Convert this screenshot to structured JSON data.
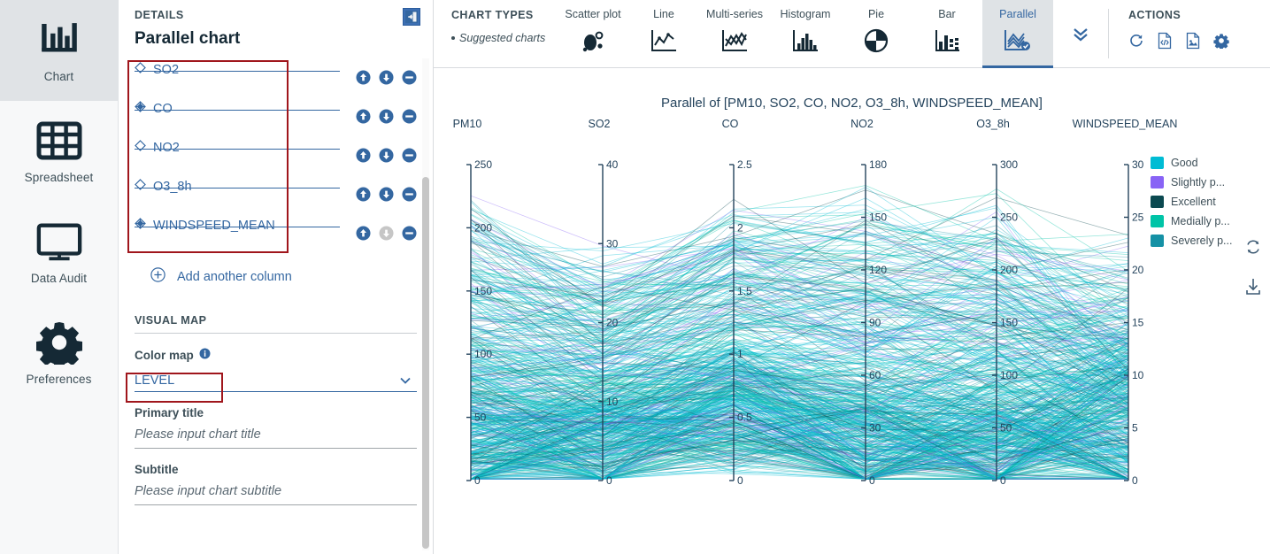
{
  "rail": {
    "items": [
      {
        "label": "Chart",
        "icon": "bar-chart-icon",
        "active": true
      },
      {
        "label": "Spreadsheet",
        "icon": "grid-icon",
        "active": false
      },
      {
        "label": "Data Audit",
        "icon": "monitor-icon",
        "active": false
      },
      {
        "label": "Preferences",
        "icon": "gear-icon",
        "active": false
      }
    ]
  },
  "details": {
    "kicker": "DETAILS",
    "title": "Parallel chart",
    "collapse_icon": "collapse-panel-icon",
    "columns": [
      {
        "name": "SO2",
        "icon": "diamond-outline-icon",
        "up": "move-up-icon",
        "down": "move-down-icon",
        "remove": "remove-icon",
        "down_disabled": false
      },
      {
        "name": "CO",
        "icon": "diamond-filled-icon",
        "up": "move-up-icon",
        "down": "move-down-icon",
        "remove": "remove-icon",
        "down_disabled": false
      },
      {
        "name": "NO2",
        "icon": "diamond-outline-icon",
        "up": "move-up-icon",
        "down": "move-down-icon",
        "remove": "remove-icon",
        "down_disabled": false
      },
      {
        "name": "O3_8h",
        "icon": "diamond-outline-icon",
        "up": "move-up-icon",
        "down": "move-down-icon",
        "remove": "remove-icon",
        "down_disabled": false
      },
      {
        "name": "WINDSPEED_MEAN",
        "icon": "diamond-filled-icon",
        "up": "move-up-icon",
        "down": "move-down-icon",
        "remove": "remove-icon",
        "down_disabled": true
      }
    ],
    "add_column_label": "Add another column",
    "visual_map_header": "VISUAL MAP",
    "color_map_label": "Color map",
    "color_map_value": "LEVEL",
    "primary_title_label": "Primary title",
    "primary_title_value": "",
    "primary_title_placeholder": "Please input chart title",
    "subtitle_label": "Subtitle",
    "subtitle_value": "",
    "subtitle_placeholder": "Please input chart subtitle"
  },
  "topbar": {
    "chart_types_label": "CHART TYPES",
    "suggested_label": "Suggested charts",
    "types": [
      {
        "label": "Scatter plot",
        "icon": "scatter-plot-icon",
        "selected": false
      },
      {
        "label": "Line",
        "icon": "line-chart-icon",
        "selected": false
      },
      {
        "label": "Multi-series",
        "icon": "multi-series-icon",
        "selected": false
      },
      {
        "label": "Histogram",
        "icon": "histogram-icon",
        "selected": false
      },
      {
        "label": "Pie",
        "icon": "pie-chart-icon",
        "selected": false
      },
      {
        "label": "Bar",
        "icon": "bar-chart-icon",
        "selected": false
      },
      {
        "label": "Parallel",
        "icon": "parallel-chart-icon",
        "selected": true
      }
    ],
    "more_icon": "chevron-double-down-icon",
    "actions_label": "ACTIONS",
    "actions": [
      {
        "name": "refresh-icon"
      },
      {
        "name": "code-export-icon"
      },
      {
        "name": "image-export-icon"
      },
      {
        "name": "settings-gear-icon"
      }
    ]
  },
  "side_tools": [
    {
      "name": "reset-zoom-icon"
    },
    {
      "name": "download-icon"
    }
  ],
  "chart_data": {
    "type": "parallel",
    "title": "Parallel of [PM10, SO2, CO, NO2, O3_8h, WINDSPEED_MEAN]",
    "axes": [
      {
        "name": "PM10",
        "ticks": [
          0,
          50,
          100,
          150,
          200,
          250
        ],
        "min": 0,
        "max": 250
      },
      {
        "name": "SO2",
        "ticks": [
          0,
          10,
          20,
          30,
          40
        ],
        "min": 0,
        "max": 40
      },
      {
        "name": "CO",
        "ticks": [
          0,
          0.5,
          1,
          1.5,
          2,
          2.5
        ],
        "min": 0,
        "max": 2.5
      },
      {
        "name": "NO2",
        "ticks": [
          0,
          30,
          60,
          90,
          120,
          150,
          180
        ],
        "min": 0,
        "max": 180
      },
      {
        "name": "O3_8h",
        "ticks": [
          0,
          50,
          100,
          150,
          200,
          250,
          300
        ],
        "min": 0,
        "max": 300
      },
      {
        "name": "WINDSPEED_MEAN",
        "ticks": [
          0,
          5,
          10,
          15,
          20,
          25,
          30
        ],
        "min": 0,
        "max": 30
      }
    ],
    "color_by": "LEVEL",
    "legend": [
      {
        "label": "Good",
        "color": "#00bcd4"
      },
      {
        "label": "Slightly p...",
        "color": "#8863f5"
      },
      {
        "label": "Excellent",
        "color": "#0b4950"
      },
      {
        "label": "Medially p...",
        "color": "#00c4a7"
      },
      {
        "label": "Severely p...",
        "color": "#1591a5"
      }
    ],
    "legend_position": "right",
    "grid": false
  }
}
